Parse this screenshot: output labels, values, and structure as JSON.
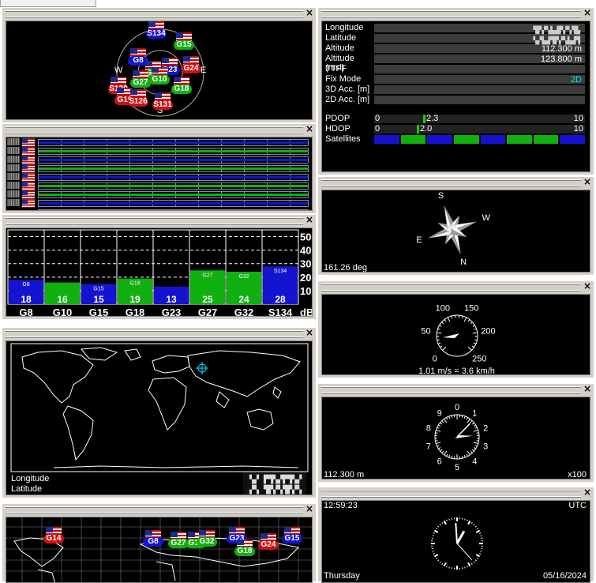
{
  "close_glyph": "×",
  "skyplot": {
    "compass": {
      "n": "S",
      "s": "S",
      "e": "E",
      "w": "W"
    },
    "satellites": [
      {
        "id": "S134",
        "c": "b"
      },
      {
        "id": "G15",
        "c": "g"
      },
      {
        "id": "G8",
        "c": "b"
      },
      {
        "id": "G32",
        "c": "g"
      },
      {
        "id": "G23",
        "c": "b"
      },
      {
        "id": "G24",
        "c": "r"
      },
      {
        "id": "G27",
        "c": "g"
      },
      {
        "id": "G10",
        "c": "g"
      },
      {
        "id": "G18",
        "c": "g"
      },
      {
        "id": "S120",
        "c": "r"
      },
      {
        "id": "G16",
        "c": "r"
      },
      {
        "id": "S126",
        "c": "r"
      },
      {
        "id": "S131",
        "c": "r"
      }
    ]
  },
  "signal_chart_data": {
    "type": "bar",
    "categories": [
      "G8",
      "G10",
      "G15",
      "G18",
      "G23",
      "G27",
      "G32",
      "S134"
    ],
    "inner_labels": [
      "G8",
      "",
      "G15",
      "G18",
      "",
      "G27",
      "G32",
      "S134"
    ],
    "values": [
      18,
      16,
      15,
      19,
      13,
      25,
      24,
      28
    ],
    "colors": [
      "#1414d0",
      "#10b010",
      "#1414d0",
      "#10b010",
      "#1414d0",
      "#10b010",
      "#10b010",
      "#1414d0"
    ],
    "ylim": [
      0,
      55
    ],
    "yticks": [
      "50",
      "40",
      "30",
      "20",
      "10"
    ],
    "unit": "dB"
  },
  "worldmap": {
    "longitude_label": "Longitude",
    "latitude_label": "Latitude"
  },
  "info": {
    "rows": [
      {
        "label": "Longitude",
        "value": ""
      },
      {
        "label": "Latitude",
        "value": ""
      },
      {
        "label": "Altitude",
        "value": "112.300 m"
      },
      {
        "label": "Altitude (msl)",
        "value": "123.800 m"
      },
      {
        "label": "TTFF",
        "value": ""
      },
      {
        "label": "Fix Mode",
        "value": "2D"
      },
      {
        "label": "3D Acc. [m]",
        "value": ""
      },
      {
        "label": "2D Acc. [m]",
        "value": ""
      }
    ],
    "pdop": {
      "label": "PDOP",
      "min": "0",
      "max": "10",
      "value": "2.3",
      "level": 0.23
    },
    "hdop": {
      "label": "HDOP",
      "min": "0",
      "max": "10",
      "value": "2.0",
      "level": 0.2
    },
    "satellites_label": "Satellites",
    "satellite_bar_colors": [
      "#1414d0",
      "#10b010",
      "#1414d0",
      "#10b010",
      "#1414d0",
      "#10b010",
      "#10b010",
      "#1414d0"
    ],
    "fix_color": "#00e5ff"
  },
  "compass": {
    "heading": 161.26,
    "text": "161.26 deg",
    "labels": {
      "n": "N",
      "s": "S",
      "e": "E",
      "w": "W"
    }
  },
  "speedometer": {
    "scale": [
      "0",
      "50",
      "100",
      "150",
      "200",
      "250"
    ],
    "speed_mps": 1.01,
    "text": "1.01 m/s = 3.6 km/h"
  },
  "altimeter": {
    "scale": [
      "0",
      "1",
      "2",
      "3",
      "4",
      "5",
      "6",
      "7",
      "8",
      "9"
    ],
    "text": "112.300 m",
    "multiplier": "x100",
    "altitude": 112.3
  },
  "clock": {
    "time": "12:59:23",
    "zone": "UTC",
    "day": "Thursday",
    "date": "05/16/2024",
    "hours": 12,
    "minutes": 59,
    "seconds": 23
  },
  "satmap": {
    "satellites": [
      {
        "id": "G14",
        "c": "r"
      },
      {
        "id": "G8",
        "c": "b"
      },
      {
        "id": "G27",
        "c": "g"
      },
      {
        "id": "G10",
        "c": "g"
      },
      {
        "id": "G32",
        "c": "g"
      },
      {
        "id": "G23",
        "c": "b"
      },
      {
        "id": "G18",
        "c": "g"
      },
      {
        "id": "G24",
        "c": "r"
      },
      {
        "id": "G15",
        "c": "b"
      }
    ]
  }
}
